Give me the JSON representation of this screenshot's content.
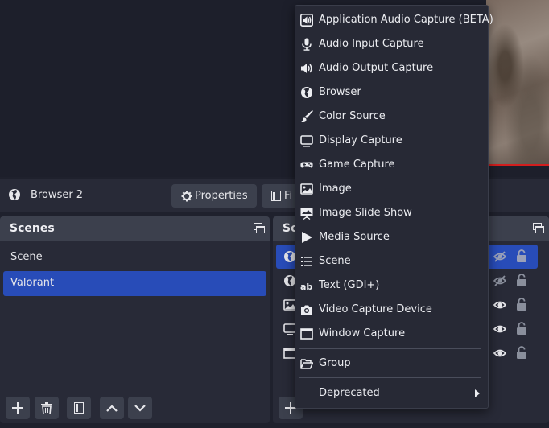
{
  "context_bar": {
    "selected_source": "Browser 2",
    "properties_label": "Properties",
    "filters_label": "Fi"
  },
  "scenes": {
    "title": "Scenes",
    "items": [
      "Scene",
      "Valorant"
    ],
    "active": "Valorant"
  },
  "sources": {
    "title_partial": "So"
  },
  "add_source_menu": {
    "items": [
      {
        "label": "Application Audio Capture (BETA)",
        "icon": "speaker-box-icon"
      },
      {
        "label": "Audio Input Capture",
        "icon": "microphone-icon"
      },
      {
        "label": "Audio Output Capture",
        "icon": "speaker-icon"
      },
      {
        "label": "Browser",
        "icon": "globe-icon"
      },
      {
        "label": "Color Source",
        "icon": "paintbrush-icon"
      },
      {
        "label": "Display Capture",
        "icon": "monitor-icon"
      },
      {
        "label": "Game Capture",
        "icon": "gamepad-icon"
      },
      {
        "label": "Image",
        "icon": "image-icon"
      },
      {
        "label": "Image Slide Show",
        "icon": "slideshow-icon"
      },
      {
        "label": "Media Source",
        "icon": "play-icon"
      },
      {
        "label": "Scene",
        "icon": "list-icon"
      },
      {
        "label": "Text (GDI+)",
        "icon": "text-icon"
      },
      {
        "label": "Video Capture Device",
        "icon": "camera-icon"
      },
      {
        "label": "Window Capture",
        "icon": "window-icon"
      }
    ],
    "group_label": "Group",
    "deprecated_label": "Deprecated"
  },
  "colors": {
    "accent": "#284cb8",
    "panel": "#282a37",
    "header": "#3c404d",
    "background": "#1f212d",
    "preview_border": "#d21e1e"
  }
}
